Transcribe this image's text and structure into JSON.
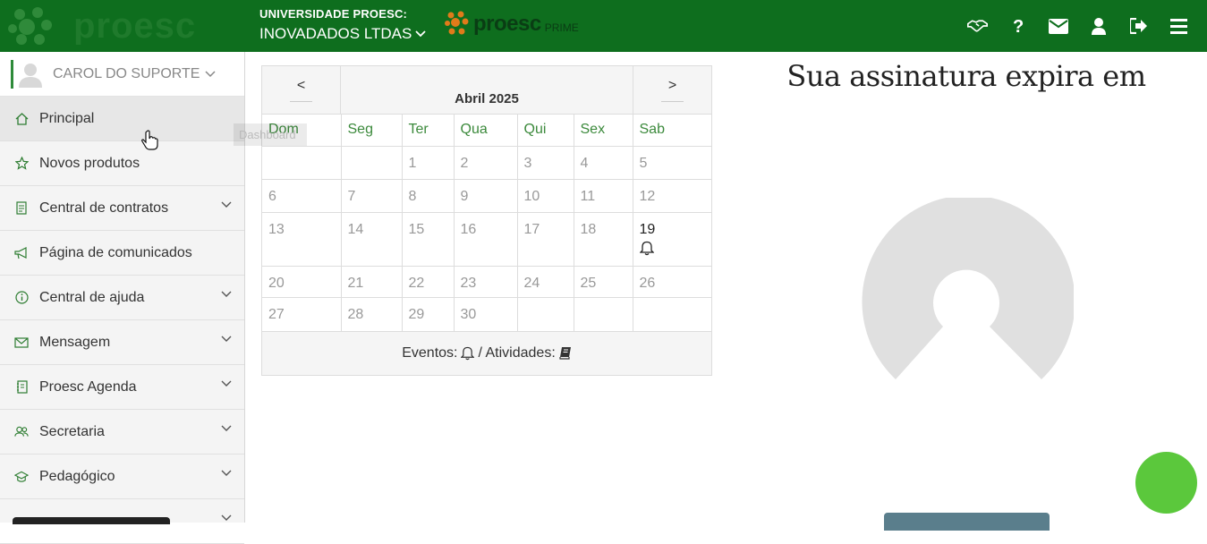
{
  "header": {
    "university": "UNIVERSIDADE PROESC:",
    "company": "INOVADADOS LTDAS",
    "logo_text": "proesc",
    "prime_name": "proesc",
    "prime_sub": "PRIME",
    "icons": [
      "handshake-icon",
      "question-icon",
      "envelope-icon",
      "user-icon",
      "sign-out-icon",
      "menu-icon"
    ]
  },
  "sidebar": {
    "user_name": "CAROL DO SUPORTE",
    "items": [
      {
        "label": "Principal",
        "icon": "home-icon",
        "has_submenu": false
      },
      {
        "label": "Novos produtos",
        "icon": "star-icon",
        "has_submenu": false
      },
      {
        "label": "Central de contratos",
        "icon": "document-icon",
        "has_submenu": true
      },
      {
        "label": "Página de comunicados",
        "icon": "megaphone-icon",
        "has_submenu": false
      },
      {
        "label": "Central de ajuda",
        "icon": "info-icon",
        "has_submenu": true
      },
      {
        "label": "Mensagem",
        "icon": "envelope-icon",
        "has_submenu": true
      },
      {
        "label": "Proesc Agenda",
        "icon": "notebook-icon",
        "has_submenu": true
      },
      {
        "label": "Secretaria",
        "icon": "users-icon",
        "has_submenu": true
      },
      {
        "label": "Pedagógico",
        "icon": "graduation-cap-icon",
        "has_submenu": true
      }
    ],
    "tooltip": "Dashboard"
  },
  "calendar": {
    "prev_label": "<",
    "next_label": ">",
    "title": "Abril 2025",
    "weekdays": [
      "Dom",
      "Seg",
      "Ter",
      "Qua",
      "Qui",
      "Sex",
      "Sab"
    ],
    "weeks": [
      [
        "",
        "",
        "1",
        "2",
        "3",
        "4",
        "5"
      ],
      [
        "6",
        "7",
        "8",
        "9",
        "10",
        "11",
        "12"
      ],
      [
        "13",
        "14",
        "15",
        "16",
        "17",
        "18",
        "19"
      ],
      [
        "20",
        "21",
        "22",
        "23",
        "24",
        "25",
        "26"
      ],
      [
        "27",
        "28",
        "29",
        "30",
        "",
        "",
        ""
      ]
    ],
    "today": "19",
    "event_days": [
      "19"
    ],
    "footer_events": "Eventos:",
    "footer_activities": "/ Atividades:"
  },
  "subscription": {
    "title": "Sua assinatura expira em"
  },
  "colors": {
    "header_bg": "#0e6e1e",
    "accent_green": "#3c8a3c",
    "chat_green": "#5bc83c",
    "prime_orange": "#e07b1a"
  }
}
